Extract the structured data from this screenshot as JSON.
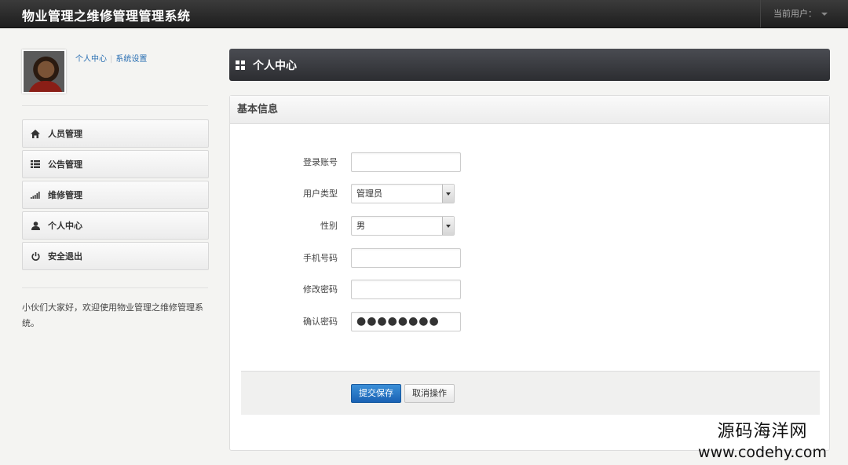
{
  "app": {
    "title": "物业管理之维修管理管理系统",
    "current_user_label": "当前用户："
  },
  "sidebar": {
    "links": [
      {
        "label": "个人中心"
      },
      {
        "label": "系统设置"
      }
    ],
    "items": [
      {
        "label": "人员管理",
        "icon": "home-icon"
      },
      {
        "label": "公告管理",
        "icon": "list-icon"
      },
      {
        "label": "维修管理",
        "icon": "signal-bars-icon"
      },
      {
        "label": "个人中心",
        "icon": "user-icon"
      },
      {
        "label": "安全退出",
        "icon": "power-icon"
      }
    ],
    "welcome": "小伙们大家好，欢迎使用物业管理之维修管理系统。"
  },
  "main": {
    "page_title": "个人中心",
    "panel_title": "基本信息",
    "form": {
      "login_account": {
        "label": "登录账号",
        "value": ""
      },
      "user_type": {
        "label": "用户类型",
        "value": "管理员"
      },
      "gender": {
        "label": "性别",
        "value": "男"
      },
      "phone": {
        "label": "手机号码",
        "value": ""
      },
      "new_password": {
        "label": "修改密码",
        "value": ""
      },
      "confirm_password": {
        "label": "确认密码",
        "value": "●●●●●●●●"
      }
    },
    "buttons": {
      "submit": "提交保存",
      "cancel": "取消操作"
    }
  },
  "watermark": {
    "text_cn": "源码海洋网",
    "url": "www.codehy.com"
  }
}
